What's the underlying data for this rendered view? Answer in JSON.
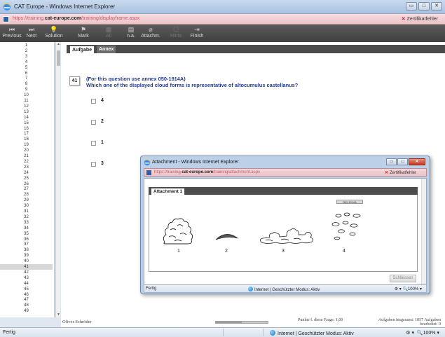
{
  "window": {
    "title": "CAT Europe - Windows Internet Explorer",
    "minimize": "▭",
    "maximize": "□",
    "close": "✕"
  },
  "address": {
    "url_prefix": "https://training.",
    "url_domain": "cat-europe.com",
    "url_rest": "/training/displayframe.aspx",
    "cert_label": "Zertifikatfehler"
  },
  "toolbar": {
    "buttons": [
      {
        "label": "Previous",
        "icon": "first-icon",
        "glyph": "⏮",
        "disabled": false
      },
      {
        "label": "Next",
        "icon": "last-icon",
        "glyph": "⏭",
        "disabled": false
      },
      {
        "label": "Solution",
        "icon": "lightbulb-icon",
        "glyph": "💡",
        "disabled": false
      },
      {
        "label": "Mark",
        "icon": "flag-icon",
        "glyph": "⚑",
        "disabled": false
      },
      {
        "label": "All",
        "icon": "grid-icon",
        "glyph": "▦",
        "disabled": true
      },
      {
        "label": "n.a.",
        "icon": "list-icon",
        "glyph": "▤",
        "disabled": false
      },
      {
        "label": "Attachm.",
        "icon": "paperclip-icon",
        "glyph": "⌀",
        "disabled": false
      },
      {
        "label": "Hints",
        "icon": "hint-icon",
        "glyph": "☐",
        "disabled": true
      },
      {
        "label": "Finish",
        "icon": "exit-icon",
        "glyph": "⇥",
        "disabled": false
      }
    ]
  },
  "question_list": {
    "numbers": [
      "1",
      "2",
      "3",
      "4",
      "5",
      "6",
      "7",
      "8",
      "9",
      "10",
      "11",
      "12",
      "13",
      "14",
      "15",
      "16",
      "17",
      "18",
      "19",
      "20",
      "21",
      "22",
      "23",
      "24",
      "25",
      "26",
      "27",
      "28",
      "29",
      "30",
      "31",
      "32",
      "33",
      "34",
      "35",
      "36",
      "37",
      "38",
      "39",
      "40",
      "41",
      "42",
      "43",
      "44",
      "45",
      "46",
      "47",
      "48",
      "49"
    ],
    "selected": "41"
  },
  "tabs": {
    "active": "Aufgabe",
    "inactive": "Annex"
  },
  "question": {
    "number": "41",
    "line1": "(For this question use annex 050-1914A)",
    "line2": "Which one of the displayed cloud forms is representative of altocumulus castellanus?",
    "answers": [
      "4",
      "2",
      "1",
      "3"
    ]
  },
  "footer": {
    "user": "Oliver Schröder",
    "progress": 0.5,
    "points": "Punkte f. diese Frage: 1,00",
    "total_line1": "Aufgaben insgesamt: 1057   Aufgaben",
    "total_line2": "bearbeitet: 0"
  },
  "status": {
    "text": "Fertig",
    "zone": "Internet | Geschützter Modus: Aktiv",
    "zoom": "100%"
  },
  "popup": {
    "title": "Attachment - Windows Internet Explorer",
    "url_prefix": "https://training.",
    "url_domain": "cat-europe.com",
    "url_rest": "/training/attachment.aspx",
    "cert_label": "Zertifikatfehler",
    "tab": "Attachment 1",
    "annex_code": "050-1914A",
    "cloud_labels": [
      "1",
      "2",
      "3",
      "4"
    ],
    "close_button": "Schliessen",
    "status": "Fertig",
    "zone": "Internet | Geschützter Modus: Aktiv",
    "zoom": "100%"
  },
  "colors": {
    "question_text": "#223a8c",
    "toolbar_bg": "#4a4a4a",
    "cert_error": "#c02020"
  }
}
